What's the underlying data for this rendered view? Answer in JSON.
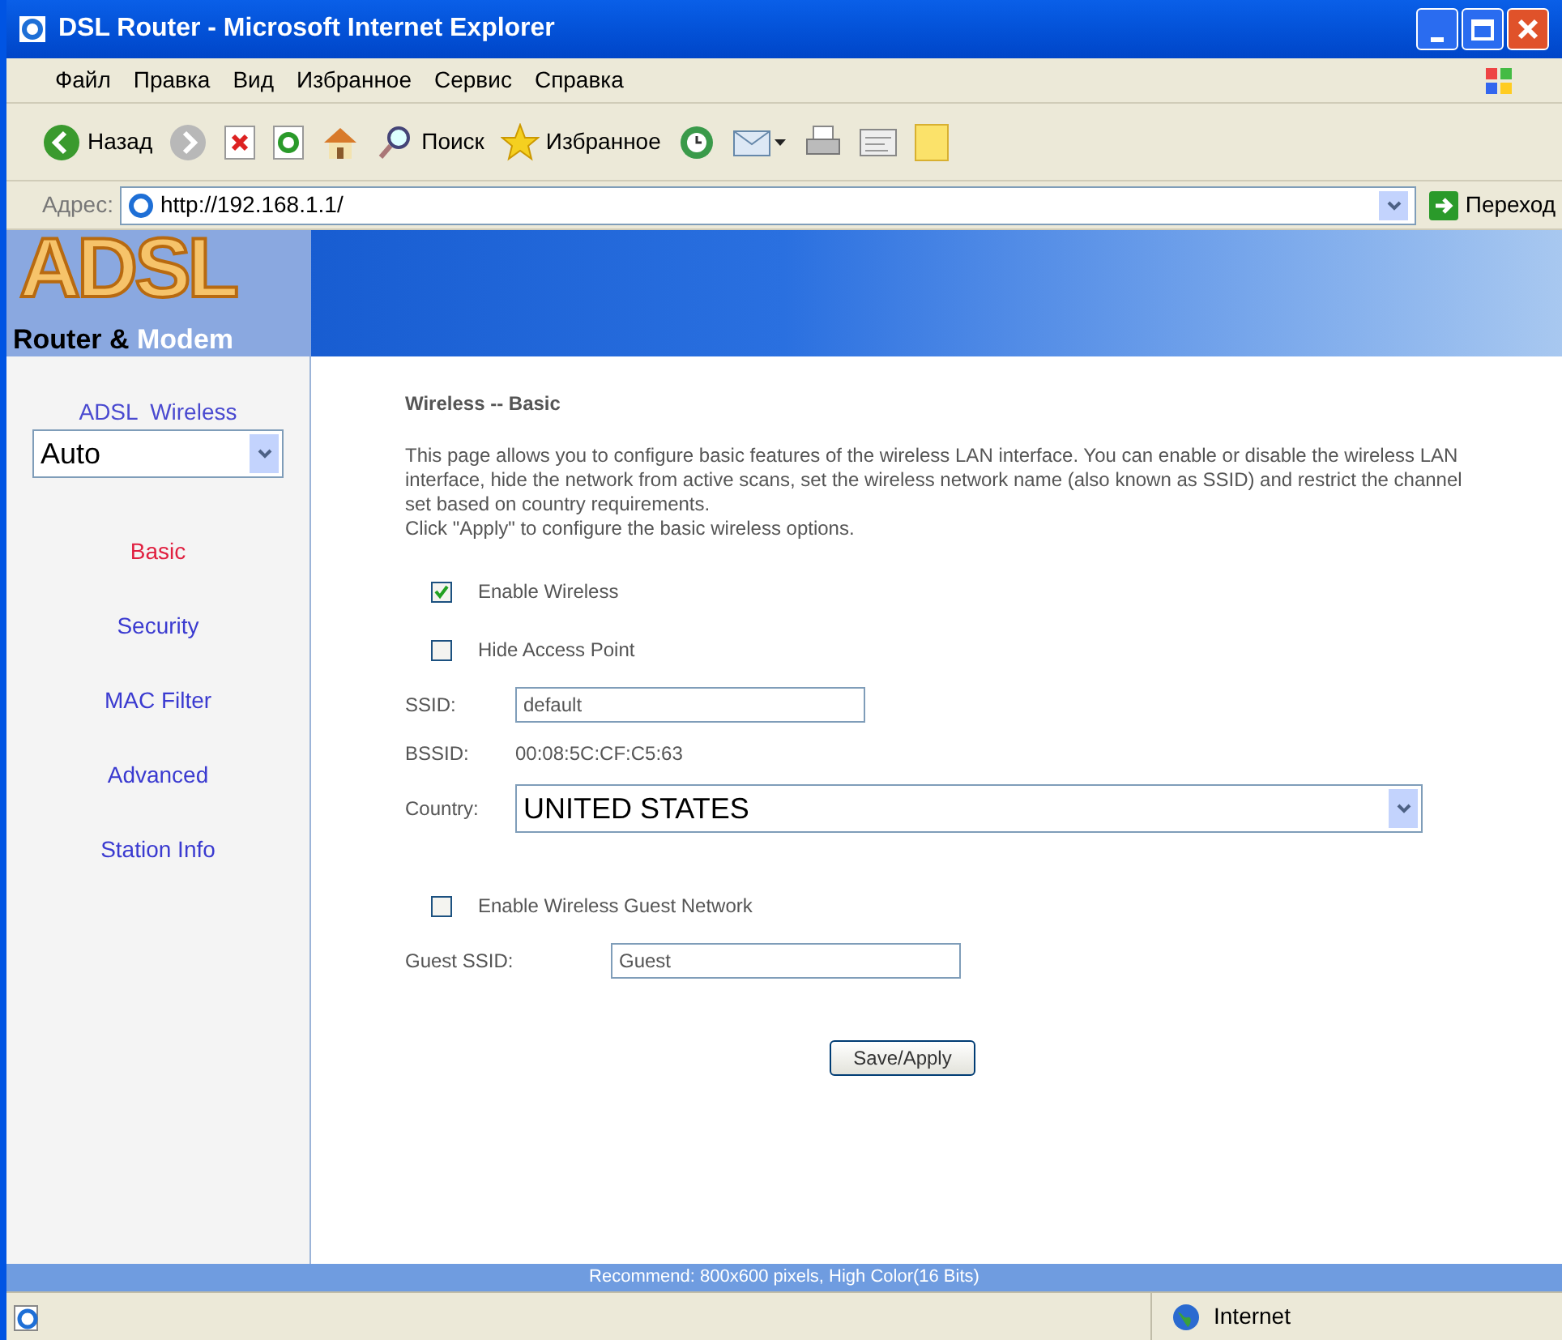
{
  "window": {
    "title": "DSL Router - Microsoft Internet Explorer"
  },
  "menu": [
    "Файл",
    "Правка",
    "Вид",
    "Избранное",
    "Сервис",
    "Справка"
  ],
  "toolbar": [
    {
      "kind": "back",
      "label": "Назад"
    },
    {
      "kind": "forward"
    },
    {
      "kind": "stop"
    },
    {
      "kind": "refresh"
    },
    {
      "kind": "home"
    },
    {
      "kind": "search",
      "label": "Поиск"
    },
    {
      "kind": "favorites",
      "label": "Избранное"
    },
    {
      "kind": "history"
    },
    {
      "kind": "mail"
    },
    {
      "kind": "print"
    },
    {
      "kind": "edit"
    },
    {
      "kind": "note"
    }
  ],
  "address": {
    "label": "Адрес:",
    "value": "http://192.168.1.1/",
    "go": "Переход"
  },
  "logo": {
    "big": "ADSL",
    "small": "Router &",
    "accent": "Modem"
  },
  "sidebar": {
    "heading": "ADSL  Wireless",
    "mode": "Auto",
    "items": [
      {
        "label": "Basic",
        "selected": true
      },
      {
        "label": "Security",
        "selected": false
      },
      {
        "label": "MAC Filter",
        "selected": false
      },
      {
        "label": "Advanced",
        "selected": false
      },
      {
        "label": "Station Info",
        "selected": false
      }
    ]
  },
  "content": {
    "title": "Wireless -- Basic",
    "description": [
      "This page allows you to configure basic features of the wireless LAN interface. You can enable or disable the wireless LAN interface, hide the network from active scans, set the wireless network name (also known as SSID) and restrict the channel set based on country requirements.",
      "Click \"Apply\" to configure the basic wireless options."
    ],
    "enable_wireless": {
      "label": "Enable Wireless",
      "checked": true
    },
    "hide_ap": {
      "label": "Hide Access Point",
      "checked": false
    },
    "ssid": {
      "label": "SSID:",
      "value": "default"
    },
    "bssid": {
      "label": "BSSID:",
      "value": "00:08:5C:CF:C5:63"
    },
    "country": {
      "label": "Country:",
      "value": "UNITED STATES"
    },
    "guest": {
      "label": "Enable Wireless Guest Network",
      "checked": false
    },
    "guest_ssid": {
      "label": "Guest SSID:",
      "value": "Guest"
    },
    "button": "Save/Apply"
  },
  "footer": "Recommend: 800x600 pixels, High Color(16 Bits)",
  "status_bar": {
    "zone": "Internet"
  }
}
